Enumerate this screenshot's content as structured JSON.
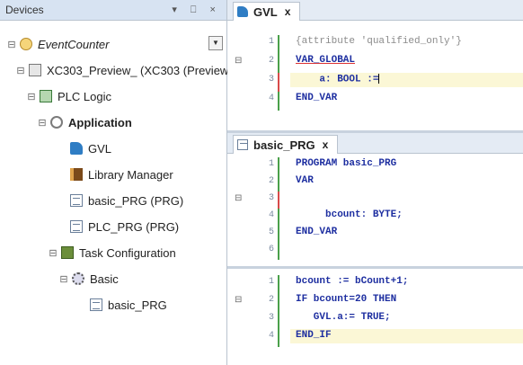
{
  "devices": {
    "title": "Devices",
    "controls": "▾ ⎕ ×",
    "tree": [
      {
        "label": "EventCounter",
        "expander": "⊟",
        "icon": "counter",
        "italic": true
      },
      {
        "label": "XC303_Preview_ (XC303 (Preview))",
        "expander": "⊟",
        "icon": "device"
      },
      {
        "label": "PLC Logic",
        "expander": "⊟",
        "icon": "plc"
      },
      {
        "label": "Application",
        "expander": "⊟",
        "icon": "app",
        "bold": true
      },
      {
        "label": "GVL",
        "expander": "",
        "icon": "gvl"
      },
      {
        "label": "Library Manager",
        "expander": "",
        "icon": "library"
      },
      {
        "label": "basic_PRG (PRG)",
        "expander": "",
        "icon": "doc"
      },
      {
        "label": "PLC_PRG (PRG)",
        "expander": "",
        "icon": "doc"
      },
      {
        "label": "Task Configuration",
        "expander": "⊟",
        "icon": "task"
      },
      {
        "label": "Basic",
        "expander": "⊟",
        "icon": "gear"
      },
      {
        "label": "basic_PRG",
        "expander": "",
        "icon": "doc"
      }
    ]
  },
  "editor_gvl": {
    "tab_label": "GVL",
    "close": "x",
    "lines": [
      {
        "num": "1",
        "text": "{attribute 'qualified_only'}",
        "style": "comment"
      },
      {
        "num": "2",
        "text": "VAR_GLOBAL",
        "style": "kw"
      },
      {
        "num": "3",
        "text": "    a: BOOL :=",
        "style": "kw"
      },
      {
        "num": "4",
        "text": "END_VAR",
        "style": "kw"
      }
    ]
  },
  "editor_basic": {
    "tab_label": "basic_PRG",
    "close": "x",
    "decl_lines": [
      {
        "num": "1",
        "text": "PROGRAM basic_PRG",
        "style": "kw"
      },
      {
        "num": "2",
        "text": "VAR",
        "style": "kw"
      },
      {
        "num": "3",
        "text": "",
        "style": "plain"
      },
      {
        "num": "4",
        "text": "     bcount: BYTE;",
        "style": "kw"
      },
      {
        "num": "5",
        "text": "END_VAR",
        "style": "kw"
      },
      {
        "num": "6",
        "text": "",
        "style": "plain"
      }
    ],
    "impl_lines": [
      {
        "num": "1",
        "text": "bcount := bCount+1;",
        "style": "kw"
      },
      {
        "num": "2",
        "text": "IF bcount=20 THEN",
        "style": "kw"
      },
      {
        "num": "3",
        "text": "   GVL.a:= TRUE;",
        "style": "kw"
      },
      {
        "num": "4",
        "text": "END_IF",
        "style": "kw"
      }
    ]
  }
}
